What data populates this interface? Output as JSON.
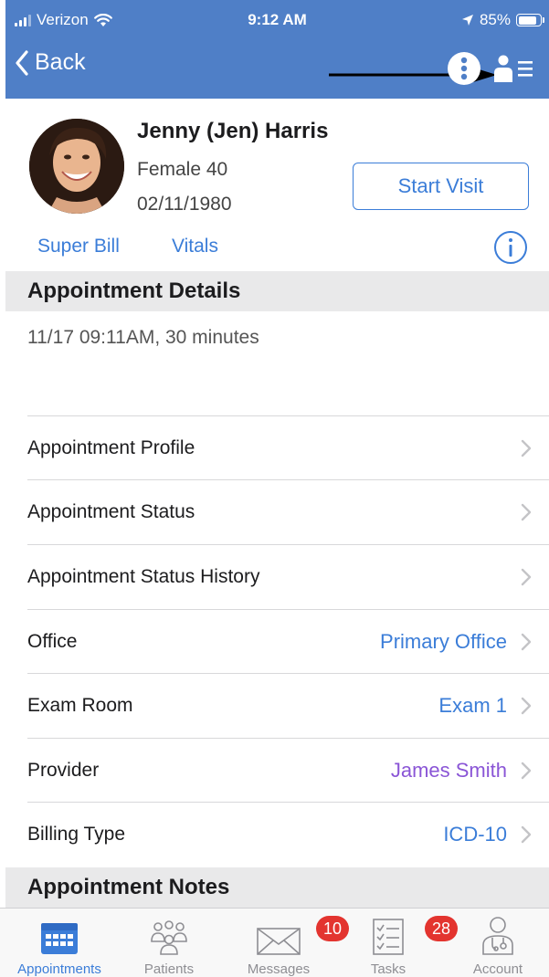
{
  "status_bar": {
    "carrier": "Verizon",
    "time": "9:12 AM",
    "battery_percent": "85%",
    "battery_level": 0.85
  },
  "nav": {
    "back_label": "Back",
    "icons": [
      "overflow-dots-icon",
      "patient-list-icon"
    ]
  },
  "patient": {
    "name": "Jenny (Jen) Harris",
    "sex_age": "Female 40",
    "dob": "02/11/1980",
    "start_visit_label": "Start Visit",
    "links": [
      "Super Bill",
      "Vitals"
    ]
  },
  "appointment_details": {
    "header": "Appointment Details",
    "summary": "11/17 09:11AM, 30 minutes",
    "rows": [
      {
        "label": "Appointment Profile",
        "value": ""
      },
      {
        "label": "Appointment Status",
        "value": ""
      },
      {
        "label": "Appointment Status History",
        "value": ""
      },
      {
        "label": "Office",
        "value": "Primary Office"
      },
      {
        "label": "Exam Room",
        "value": "Exam 1"
      },
      {
        "label": "Provider",
        "value": "James Smith"
      },
      {
        "label": "Billing Type",
        "value": "ICD-10"
      }
    ]
  },
  "appointment_notes": {
    "header": "Appointment Notes"
  },
  "tabbar": {
    "tabs": [
      {
        "label": "Appointments",
        "badge": ""
      },
      {
        "label": "Patients",
        "badge": ""
      },
      {
        "label": "Messages",
        "badge": "10"
      },
      {
        "label": "Tasks",
        "badge": "28"
      },
      {
        "label": "Account",
        "badge": ""
      }
    ]
  },
  "colors": {
    "nav_bar": "#4f7fc7",
    "link_blue": "#3b7dd8",
    "provider_purple": "#8a55d6",
    "badge_red": "#e3342f",
    "section_gray": "#e9e9ea"
  }
}
